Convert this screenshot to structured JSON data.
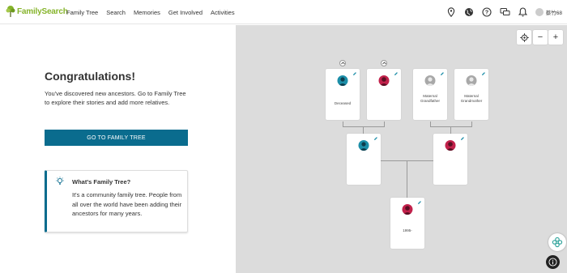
{
  "brand": {
    "name": "FamilySearch",
    "color": "#86b42b"
  },
  "nav": {
    "items": [
      "Family Tree",
      "Search",
      "Memories",
      "Get Involved",
      "Activities"
    ]
  },
  "header_tools": {
    "icons": [
      "location-pin-icon",
      "globe-icon",
      "help-icon",
      "messages-icon",
      "bell-icon"
    ],
    "user_label": "蔡竹68"
  },
  "left": {
    "title": "Congratulations!",
    "body": "You've discovered new ancestors. Go to Family Tree to explore their stories and add more relatives.",
    "cta_label": "GO TO FAMILY TREE",
    "info": {
      "heading": "What's Family Tree?",
      "text": "It's a community family tree. People from all over the world have been adding their ancestors for many years."
    }
  },
  "tree_controls": {
    "zoom_out": "−",
    "zoom_in": "+"
  },
  "tree": {
    "grandparents": [
      {
        "label": "Deceased",
        "gender": "male"
      },
      {
        "label": "",
        "gender": "female"
      },
      {
        "label": "Maternal Grandfather",
        "gender": "unknown"
      },
      {
        "label": "Maternal Grandmother",
        "gender": "unknown"
      }
    ],
    "parents": [
      {
        "label": "",
        "gender": "male"
      },
      {
        "label": "",
        "gender": "female"
      }
    ],
    "self": {
      "label": "1995-",
      "gender": "female"
    }
  },
  "colors": {
    "accent": "#0a6c8e",
    "male": "#1c8ea8",
    "female": "#c2214b",
    "unknown": "#a8a8a8"
  }
}
